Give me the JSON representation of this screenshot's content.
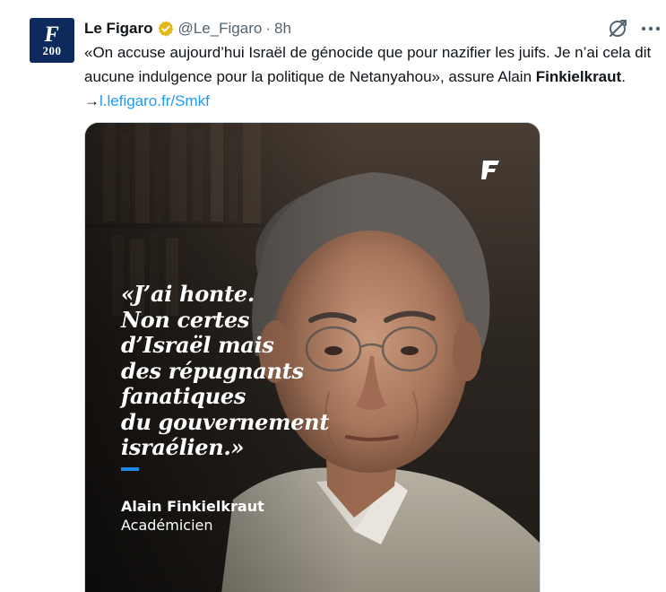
{
  "account": {
    "display_name": "Le Figaro",
    "handle": "@Le_Figaro",
    "separator": "·",
    "time": "8h",
    "avatar": {
      "glyph": "F",
      "text": "200",
      "bg_color": "#0d2a5c"
    },
    "verified_badge_color": "#e2b719"
  },
  "tweet": {
    "text_main": "«On accuse aujourd’hui Israël de génocide que pour nazifier les juifs. Je n’ai cela dit aucune indulgence pour la politique de Netanyahou», assure Alain ",
    "text_bold": "Finkielkraut",
    "text_after": ". →",
    "link_text": "l.lefigaro.fr/Smkf",
    "link_color": "#1d9bf0"
  },
  "media": {
    "quote_lines": [
      "«J’ai honte.",
      "Non certes",
      "d’Israël mais",
      "des répugnants",
      "fanatiques",
      "du gouvernement",
      "israélien.»"
    ],
    "author_name": "Alain Finkielkraut",
    "author_title": "Académicien",
    "accent_color": "#1e88e5",
    "brand_mark": "F"
  },
  "icons": {
    "grok": "grok-icon",
    "more": "more-icon"
  }
}
